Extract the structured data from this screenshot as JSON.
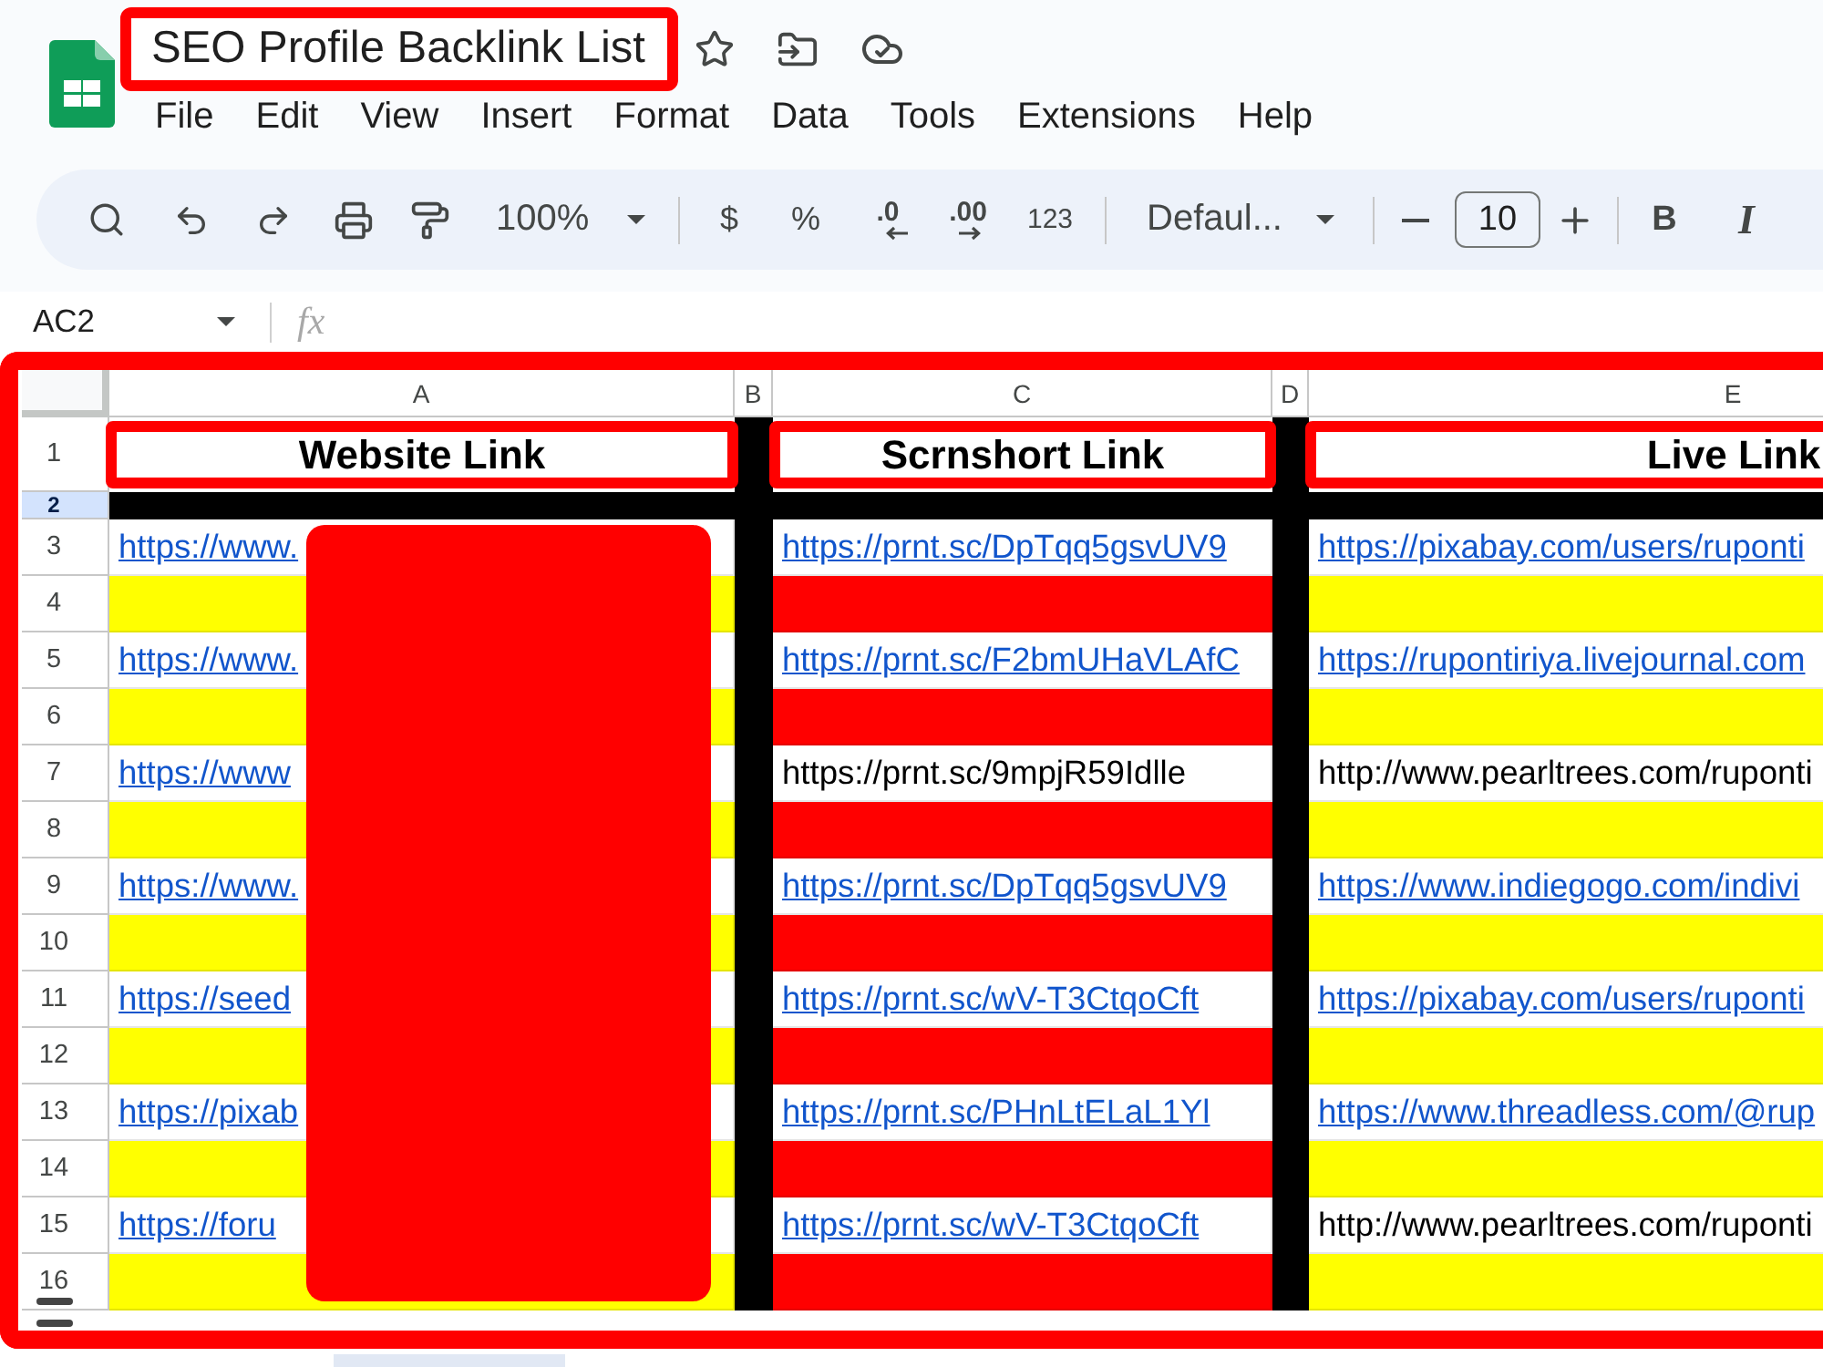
{
  "document": {
    "title": "SEO Profile Backlink List",
    "outlined": true
  },
  "menu": [
    "File",
    "Edit",
    "View",
    "Insert",
    "Format",
    "Data",
    "Tools",
    "Extensions",
    "Help"
  ],
  "toolbar": {
    "zoom": "100%",
    "currency": "$",
    "percent": "%",
    "decrease_decimal": ".0",
    "increase_decimal": ".00",
    "number_format": "123",
    "font": "Defaul...",
    "font_size": "10",
    "bold": "B",
    "italic": "I"
  },
  "formula_bar": {
    "name_box": "AC2",
    "function_label": "fx"
  },
  "sheet": {
    "columns": [
      {
        "label": "A"
      },
      {
        "label": "B"
      },
      {
        "label": "C"
      },
      {
        "label": "D"
      },
      {
        "label": "E"
      }
    ],
    "rows": [
      {
        "number": "1",
        "selected": false,
        "cells": [
          {
            "kind": "header",
            "text": "Website Link",
            "outlined": true,
            "color": "#ffffff"
          },
          {
            "kind": "blank",
            "color": "#000000"
          },
          {
            "kind": "header",
            "text": "Scrnshort Link",
            "outlined": true,
            "color": "#ffffff"
          },
          {
            "kind": "blank",
            "color": "#000000"
          },
          {
            "kind": "header",
            "text": "Live Link",
            "outlined": true,
            "color": "#ffffff"
          }
        ]
      },
      {
        "number": "2",
        "selected": true,
        "cells": [
          {
            "kind": "blank",
            "color": "#000000"
          },
          {
            "kind": "blank",
            "color": "#000000"
          },
          {
            "kind": "blank",
            "color": "#000000"
          },
          {
            "kind": "blank",
            "color": "#000000"
          },
          {
            "kind": "blank",
            "color": "#000000"
          }
        ]
      },
      {
        "number": "3",
        "selected": false,
        "cells": [
          {
            "kind": "link",
            "text": "https://www.",
            "color": "#ffffff"
          },
          {
            "kind": "blank",
            "color": "#000000"
          },
          {
            "kind": "link",
            "text": "https://prnt.sc/DpTqq5gsvUV9",
            "color": "#ffffff"
          },
          {
            "kind": "blank",
            "color": "#000000"
          },
          {
            "kind": "link",
            "text": "https://pixabay.com/users/ruponti",
            "color": "#ffffff"
          }
        ]
      },
      {
        "number": "4",
        "selected": false,
        "cells": [
          {
            "kind": "blank",
            "color": "#ffff00"
          },
          {
            "kind": "blank",
            "color": "#000000"
          },
          {
            "kind": "blank",
            "color": "#ff0000"
          },
          {
            "kind": "blank",
            "color": "#000000"
          },
          {
            "kind": "blank",
            "color": "#ffff00"
          }
        ]
      },
      {
        "number": "5",
        "selected": false,
        "cells": [
          {
            "kind": "link",
            "text": "https://www.",
            "color": "#ffffff"
          },
          {
            "kind": "blank",
            "color": "#000000"
          },
          {
            "kind": "link",
            "text": "https://prnt.sc/F2bmUHaVLAfC",
            "color": "#ffffff"
          },
          {
            "kind": "blank",
            "color": "#000000"
          },
          {
            "kind": "link",
            "text": "https://rupontiriya.livejournal.com",
            "color": "#ffffff"
          }
        ]
      },
      {
        "number": "6",
        "selected": false,
        "cells": [
          {
            "kind": "blank",
            "color": "#ffff00"
          },
          {
            "kind": "blank",
            "color": "#000000"
          },
          {
            "kind": "blank",
            "color": "#ff0000"
          },
          {
            "kind": "blank",
            "color": "#000000"
          },
          {
            "kind": "blank",
            "color": "#ffff00"
          }
        ]
      },
      {
        "number": "7",
        "selected": false,
        "cells": [
          {
            "kind": "link",
            "text": "https://www",
            "color": "#ffffff"
          },
          {
            "kind": "blank",
            "color": "#000000"
          },
          {
            "kind": "text",
            "text": "https://prnt.sc/9mpjR59Idlle",
            "color": "#ffffff"
          },
          {
            "kind": "blank",
            "color": "#000000"
          },
          {
            "kind": "text",
            "text": "http://www.pearltrees.com/ruponti",
            "color": "#ffffff"
          }
        ]
      },
      {
        "number": "8",
        "selected": false,
        "cells": [
          {
            "kind": "blank",
            "color": "#ffff00"
          },
          {
            "kind": "blank",
            "color": "#000000"
          },
          {
            "kind": "blank",
            "color": "#ff0000"
          },
          {
            "kind": "blank",
            "color": "#000000"
          },
          {
            "kind": "blank",
            "color": "#ffff00"
          }
        ]
      },
      {
        "number": "9",
        "selected": false,
        "cells": [
          {
            "kind": "link",
            "text": "https://www.",
            "color": "#ffffff"
          },
          {
            "kind": "blank",
            "color": "#000000"
          },
          {
            "kind": "link",
            "text": "https://prnt.sc/DpTqq5gsvUV9",
            "color": "#ffffff"
          },
          {
            "kind": "blank",
            "color": "#000000"
          },
          {
            "kind": "link",
            "text": "https://www.indiegogo.com/indivi",
            "color": "#ffffff"
          }
        ]
      },
      {
        "number": "10",
        "selected": false,
        "cells": [
          {
            "kind": "blank",
            "color": "#ffff00"
          },
          {
            "kind": "blank",
            "color": "#000000"
          },
          {
            "kind": "blank",
            "color": "#ff0000"
          },
          {
            "kind": "blank",
            "color": "#000000"
          },
          {
            "kind": "blank",
            "color": "#ffff00"
          }
        ]
      },
      {
        "number": "11",
        "selected": false,
        "cells": [
          {
            "kind": "link",
            "text": "https://seed",
            "color": "#ffffff"
          },
          {
            "kind": "blank",
            "color": "#000000"
          },
          {
            "kind": "link",
            "text": "https://prnt.sc/wV-T3CtqoCft",
            "color": "#ffffff"
          },
          {
            "kind": "blank",
            "color": "#000000"
          },
          {
            "kind": "link",
            "text": "https://pixabay.com/users/ruponti",
            "color": "#ffffff"
          }
        ]
      },
      {
        "number": "12",
        "selected": false,
        "cells": [
          {
            "kind": "blank",
            "color": "#ffff00"
          },
          {
            "kind": "blank",
            "color": "#000000"
          },
          {
            "kind": "blank",
            "color": "#ff0000"
          },
          {
            "kind": "blank",
            "color": "#000000"
          },
          {
            "kind": "blank",
            "color": "#ffff00"
          }
        ]
      },
      {
        "number": "13",
        "selected": false,
        "cells": [
          {
            "kind": "link",
            "text": "https://pixab",
            "color": "#ffffff"
          },
          {
            "kind": "blank",
            "color": "#000000"
          },
          {
            "kind": "link",
            "text": "https://prnt.sc/PHnLtELaL1Yl",
            "color": "#ffffff"
          },
          {
            "kind": "blank",
            "color": "#000000"
          },
          {
            "kind": "link",
            "text": "https://www.threadless.com/@rup",
            "color": "#ffffff"
          }
        ]
      },
      {
        "number": "14",
        "selected": false,
        "cells": [
          {
            "kind": "blank",
            "color": "#ffff00"
          },
          {
            "kind": "blank",
            "color": "#000000"
          },
          {
            "kind": "blank",
            "color": "#ff0000"
          },
          {
            "kind": "blank",
            "color": "#000000"
          },
          {
            "kind": "blank",
            "color": "#ffff00"
          }
        ]
      },
      {
        "number": "15",
        "selected": false,
        "cells": [
          {
            "kind": "link",
            "text": "https://foru",
            "color": "#ffffff"
          },
          {
            "kind": "blank",
            "color": "#000000"
          },
          {
            "kind": "link",
            "text": "https://prnt.sc/wV-T3CtqoCft",
            "color": "#ffffff"
          },
          {
            "kind": "blank",
            "color": "#000000"
          },
          {
            "kind": "text",
            "text": "http://www.pearltrees.com/ruponti",
            "color": "#ffffff"
          }
        ]
      },
      {
        "number": "16",
        "selected": false,
        "cells": [
          {
            "kind": "blank",
            "color": "#ffff00"
          },
          {
            "kind": "blank",
            "color": "#000000"
          },
          {
            "kind": "blank",
            "color": "#ff0000"
          },
          {
            "kind": "blank",
            "color": "#000000"
          },
          {
            "kind": "blank",
            "color": "#ffff00"
          }
        ]
      }
    ]
  }
}
